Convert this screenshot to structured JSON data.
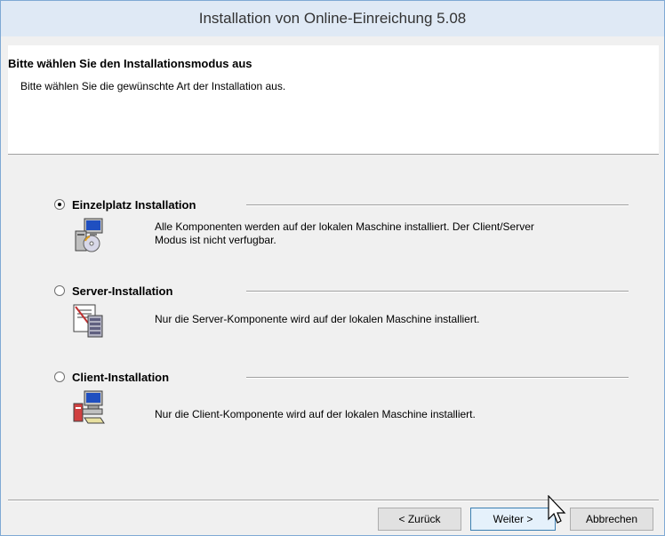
{
  "window": {
    "title": "Installation von Online-Einreichung 5.08"
  },
  "header": {
    "title": "Bitte wählen Sie den Installationsmodus aus",
    "subtitle": "Bitte wählen Sie die gewünschte Art der Installation aus."
  },
  "options": [
    {
      "label": "Einzelplatz Installation",
      "selected": true,
      "icon": "workstation-cd-icon",
      "description_line1": "Alle Komponenten werden auf der lokalen Maschine installiert. Der Client/Server",
      "description_line2": "Modus ist nicht verfugbar."
    },
    {
      "label": "Server-Installation",
      "selected": false,
      "icon": "server-icon",
      "description_line1": "Nur die Server-Komponente wird auf der lokalen Maschine installiert.",
      "description_line2": ""
    },
    {
      "label": "Client-Installation",
      "selected": false,
      "icon": "client-computer-icon",
      "description_line1": "Nur die Client-Komponente wird auf der lokalen Maschine installiert.",
      "description_line2": ""
    }
  ],
  "buttons": {
    "back": "< Zurück",
    "next": "Weiter >",
    "cancel": "Abbrechen"
  },
  "colors": {
    "title_bar": "#dfe9f5",
    "window_border": "#7fa9d4",
    "dialog_bg": "#f0f0f0",
    "header_bg": "#ffffff"
  }
}
